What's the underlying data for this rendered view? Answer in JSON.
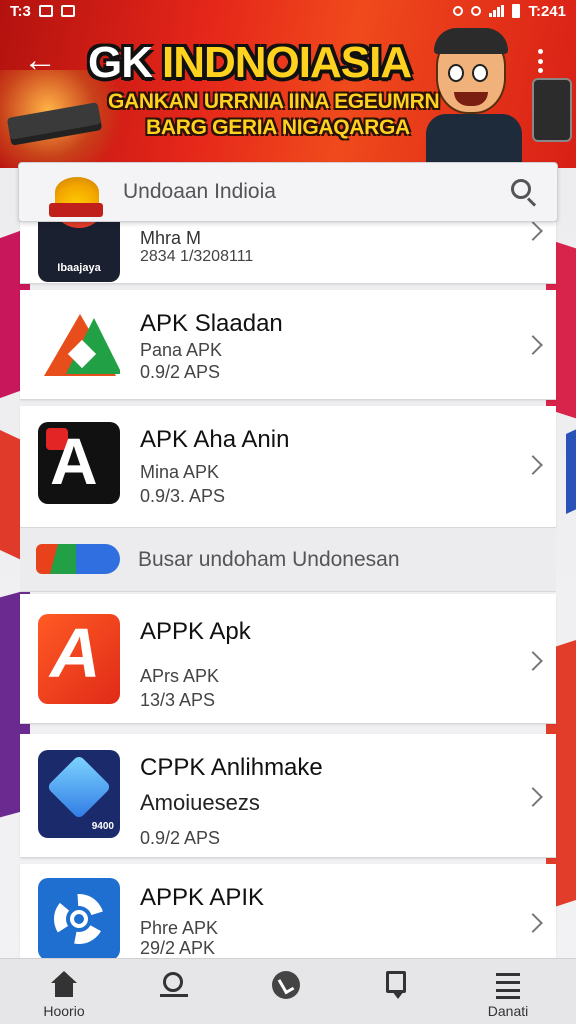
{
  "status_bar": {
    "left_time": "T:3",
    "right_time": "T:241"
  },
  "header": {
    "title_part1": "GK",
    "title_part2": "INDNOIASIA",
    "subtitle_line1": "GANKAN URRNIA IINA EGEUMRN",
    "subtitle_line2": "BARG GERIA NIGAQARGA"
  },
  "search": {
    "placeholder": "Undoaan Indioia"
  },
  "apps": [
    {
      "name": "Mhra M",
      "sub": "",
      "size": "2834 1/3208111",
      "icon": "mhra-app-icon"
    },
    {
      "name": "APK Slaadan",
      "sub": "Pana APK",
      "size": "0.9/2 APS",
      "icon": "triangle-app-icon"
    },
    {
      "name": "APK Aha Anin",
      "sub": "Mina APK",
      "size": "0.9/3. APS",
      "icon": "letter-a-app-icon"
    }
  ],
  "section": {
    "label": "Busar undoham Undonesan"
  },
  "apps2": [
    {
      "name": "APPK Apk",
      "sub": "APrs APK",
      "size": "13/3 APS",
      "icon": "apk-a-app-icon"
    },
    {
      "name": "CPPK Anlihmake",
      "sub": "Amoiuesezs",
      "size": "0.9/2 APS",
      "icon": "diamond-app-icon"
    },
    {
      "name": "APPK APIK",
      "sub": "Phre APK",
      "size": "29/2 APK",
      "icon": "gear-app-icon"
    }
  ],
  "bottom_nav": {
    "home_label": "Hoorio",
    "search_label": "",
    "pen_label": "",
    "bookmark_label": "",
    "list_label": "Danati"
  },
  "colors": {
    "header_red": "#e5261a",
    "title_yellow": "#ffd21f",
    "card_bg": "#ffffff",
    "page_bg": "#e9e9ec"
  }
}
